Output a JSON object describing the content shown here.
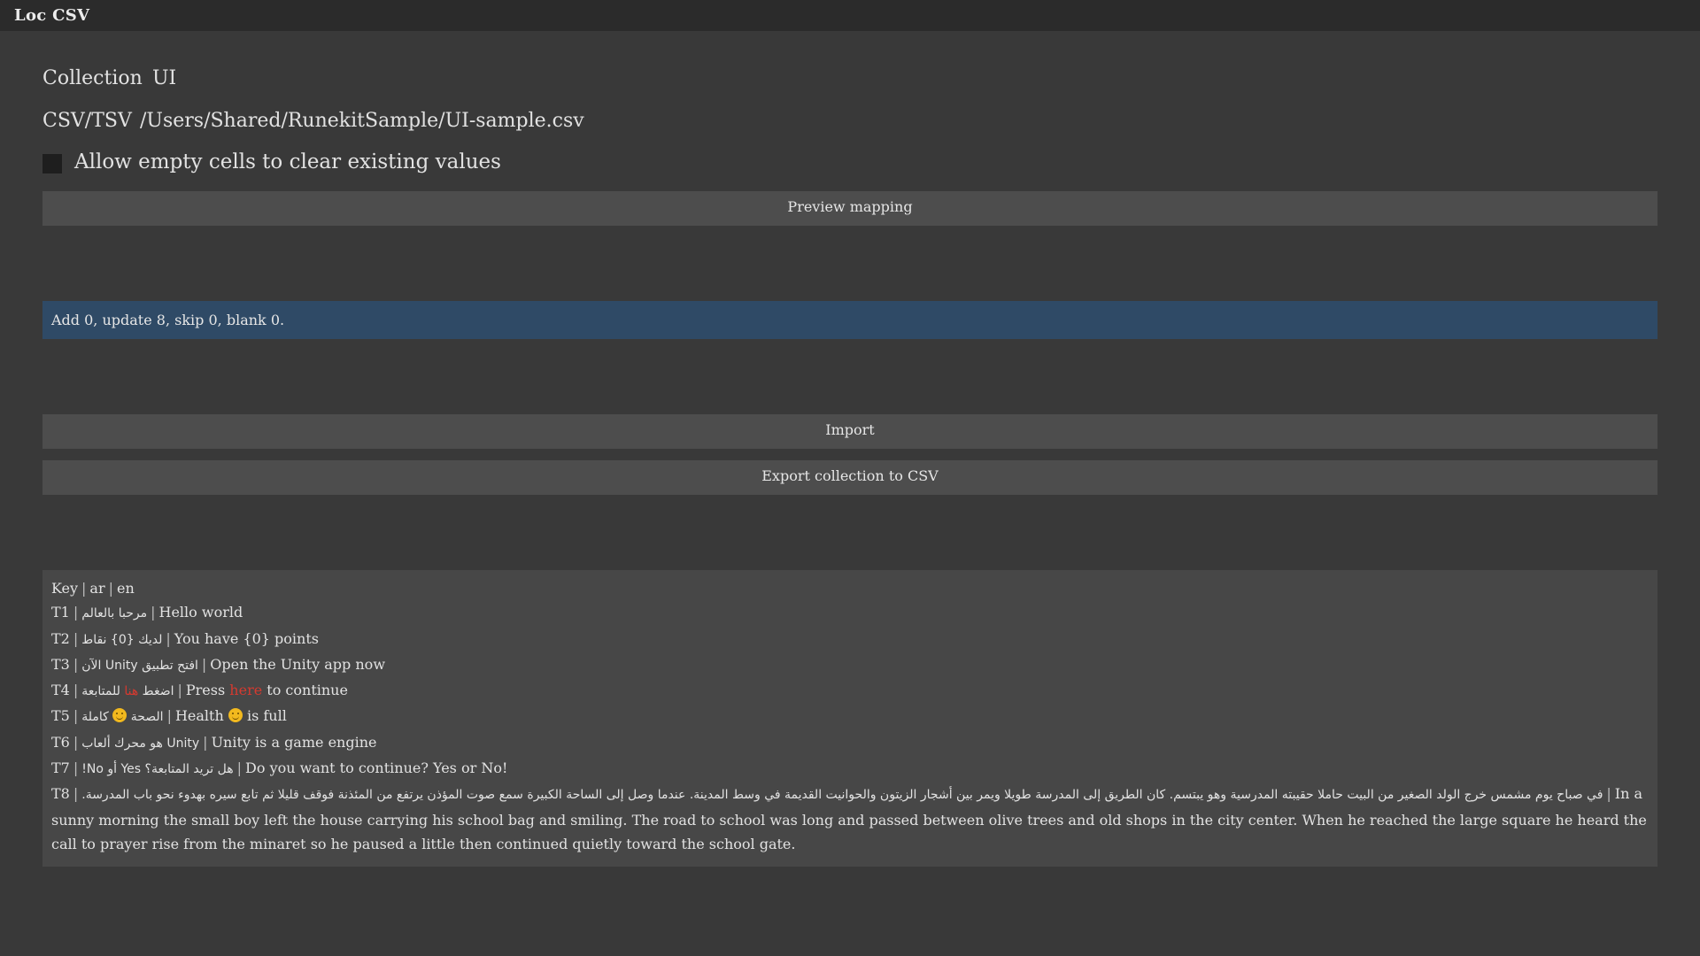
{
  "window": {
    "title": "Loc CSV"
  },
  "form": {
    "collection_label": "Collection",
    "collection_value": "UI",
    "csv_label": "CSV/TSV",
    "csv_path": "/Users/Shared/RunekitSample/UI-sample.csv",
    "allow_empty_label": "Allow empty cells to clear existing values",
    "allow_empty_checked": false
  },
  "buttons": {
    "preview": "Preview mapping",
    "import": "Import",
    "export": "Export collection to CSV"
  },
  "summary": "Add 0, update 8, skip 0, blank 0.",
  "preview_table": {
    "header": [
      "Key",
      "ar",
      "en"
    ],
    "separator": "|",
    "rows": [
      {
        "key": "T1",
        "ar": "مرحبا بالعالم",
        "en": "Hello world"
      },
      {
        "key": "T2",
        "ar": "لديك {0} نقاط",
        "en": "You have {0} points"
      },
      {
        "key": "T3",
        "ar": "افتح تطبيق Unity الآن",
        "en": "Open the Unity app now"
      },
      {
        "key": "T4",
        "ar_before": "اضغط",
        "ar_highlight": "هنا",
        "ar_after": "للمتابعة",
        "en_before": "Press",
        "en_highlight": "here",
        "en_after": "to continue"
      },
      {
        "key": "T5",
        "ar_before": "الصحة",
        "ar_after": "كاملة",
        "en_before": "Health",
        "en_after": "is full",
        "emoji": "smiling-face-icon"
      },
      {
        "key": "T6",
        "ar": "Unity هو محرك ألعاب",
        "en": "Unity is a game engine"
      },
      {
        "key": "T7",
        "ar": "هل تريد المتابعة؟ Yes أو No!",
        "en": "Do you want to continue? Yes or No!"
      },
      {
        "key": "T8",
        "ar": "في صباح يوم مشمس خرج الولد الصغير من البيت حاملا حقيبته المدرسية وهو يبتسم. كان الطريق إلى المدرسة طويلا ويمر بين أشجار الزيتون والحوانيت القديمة في وسط المدينة. عندما وصل إلى الساحة الكبيرة سمع صوت المؤذن يرتفع من المئذنة فوقف قليلا ثم تابع سيره بهدوء نحو باب المدرسة.",
        "en": "In a sunny morning the small boy left the house carrying his school bag and smiling. The road to school was long and passed between olive trees and old shops in the city center. When he reached the large square he heard the call to prayer rise from the minaret so he paused a little then continued quietly toward the school gate."
      }
    ]
  },
  "colors": {
    "background": "#393939",
    "titlebar": "#2b2b2b",
    "button": "#4d4d4d",
    "summary_bg": "#2f4a66",
    "preview_bg": "#474747",
    "highlight": "#d43a30"
  }
}
